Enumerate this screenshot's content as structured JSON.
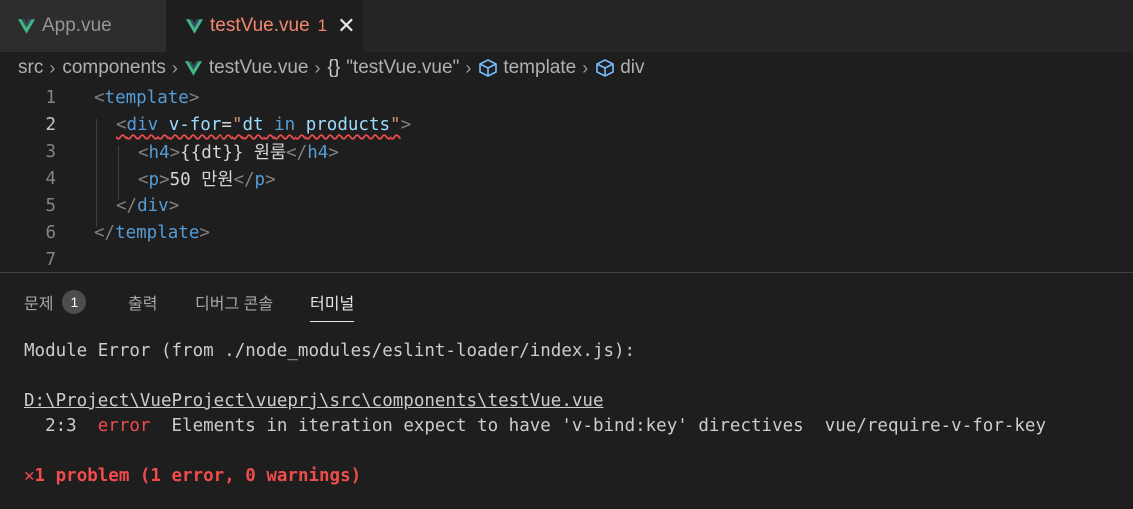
{
  "tabs": [
    {
      "label": "App.vue"
    },
    {
      "label": "testVue.vue",
      "badge": "1",
      "close": "✕"
    }
  ],
  "breadcrumb": {
    "src": "src",
    "components": "components",
    "file": "testVue.vue",
    "braces": "{}",
    "block": "\"testVue.vue\"",
    "template": "template",
    "div": "div",
    "sep": "›"
  },
  "editor": {
    "line_numbers": [
      "1",
      "2",
      "3",
      "4",
      "5",
      "6",
      "7"
    ],
    "l1": {
      "open": "<",
      "tag": "template",
      "close": ">"
    },
    "l2": {
      "open": "<",
      "tag": "div",
      "sp": " ",
      "attr": "v-for",
      "eq": "=",
      "q1": "\"",
      "a": "dt",
      "kw": "in",
      "b": "products",
      "q2": "\"",
      "close": ">"
    },
    "l3": {
      "open": "<",
      "tag": "h4",
      "close": ">",
      "text": "{{dt}} 원룸",
      "open2": "</",
      "tag2": "h4",
      "close2": ">"
    },
    "l4": {
      "open": "<",
      "tag": "p",
      "close": ">",
      "text": "50 만원",
      "open2": "</",
      "tag2": "p",
      "close2": ">"
    },
    "l5": {
      "open": "</",
      "tag": "div",
      "close": ">"
    },
    "l6": {
      "open": "</",
      "tag": "template",
      "close": ">"
    }
  },
  "panel": {
    "tabs": [
      {
        "label": "문제",
        "count": "1"
      },
      {
        "label": "출력"
      },
      {
        "label": "디버그 콘솔"
      },
      {
        "label": "터미널"
      }
    ],
    "terminal": {
      "line1": "Module Error (from ./node_modules/eslint-loader/index.js):",
      "path": "D:\\Project\\VueProject\\vueprj\\src\\components\\testVue.vue",
      "loc": "  2:3  ",
      "level": "error",
      "message": "  Elements in iteration expect to have 'v-bind:key' directives  vue/require-v-for-key",
      "summary_icon": "✕",
      "summary": "1 problem (1 error, 0 warnings)"
    }
  },
  "colors": {
    "vue_green": "#41b883",
    "error": "#f14c4c",
    "tag": "#569cd6",
    "string": "#ce9178",
    "attr": "#9cdcfe"
  }
}
